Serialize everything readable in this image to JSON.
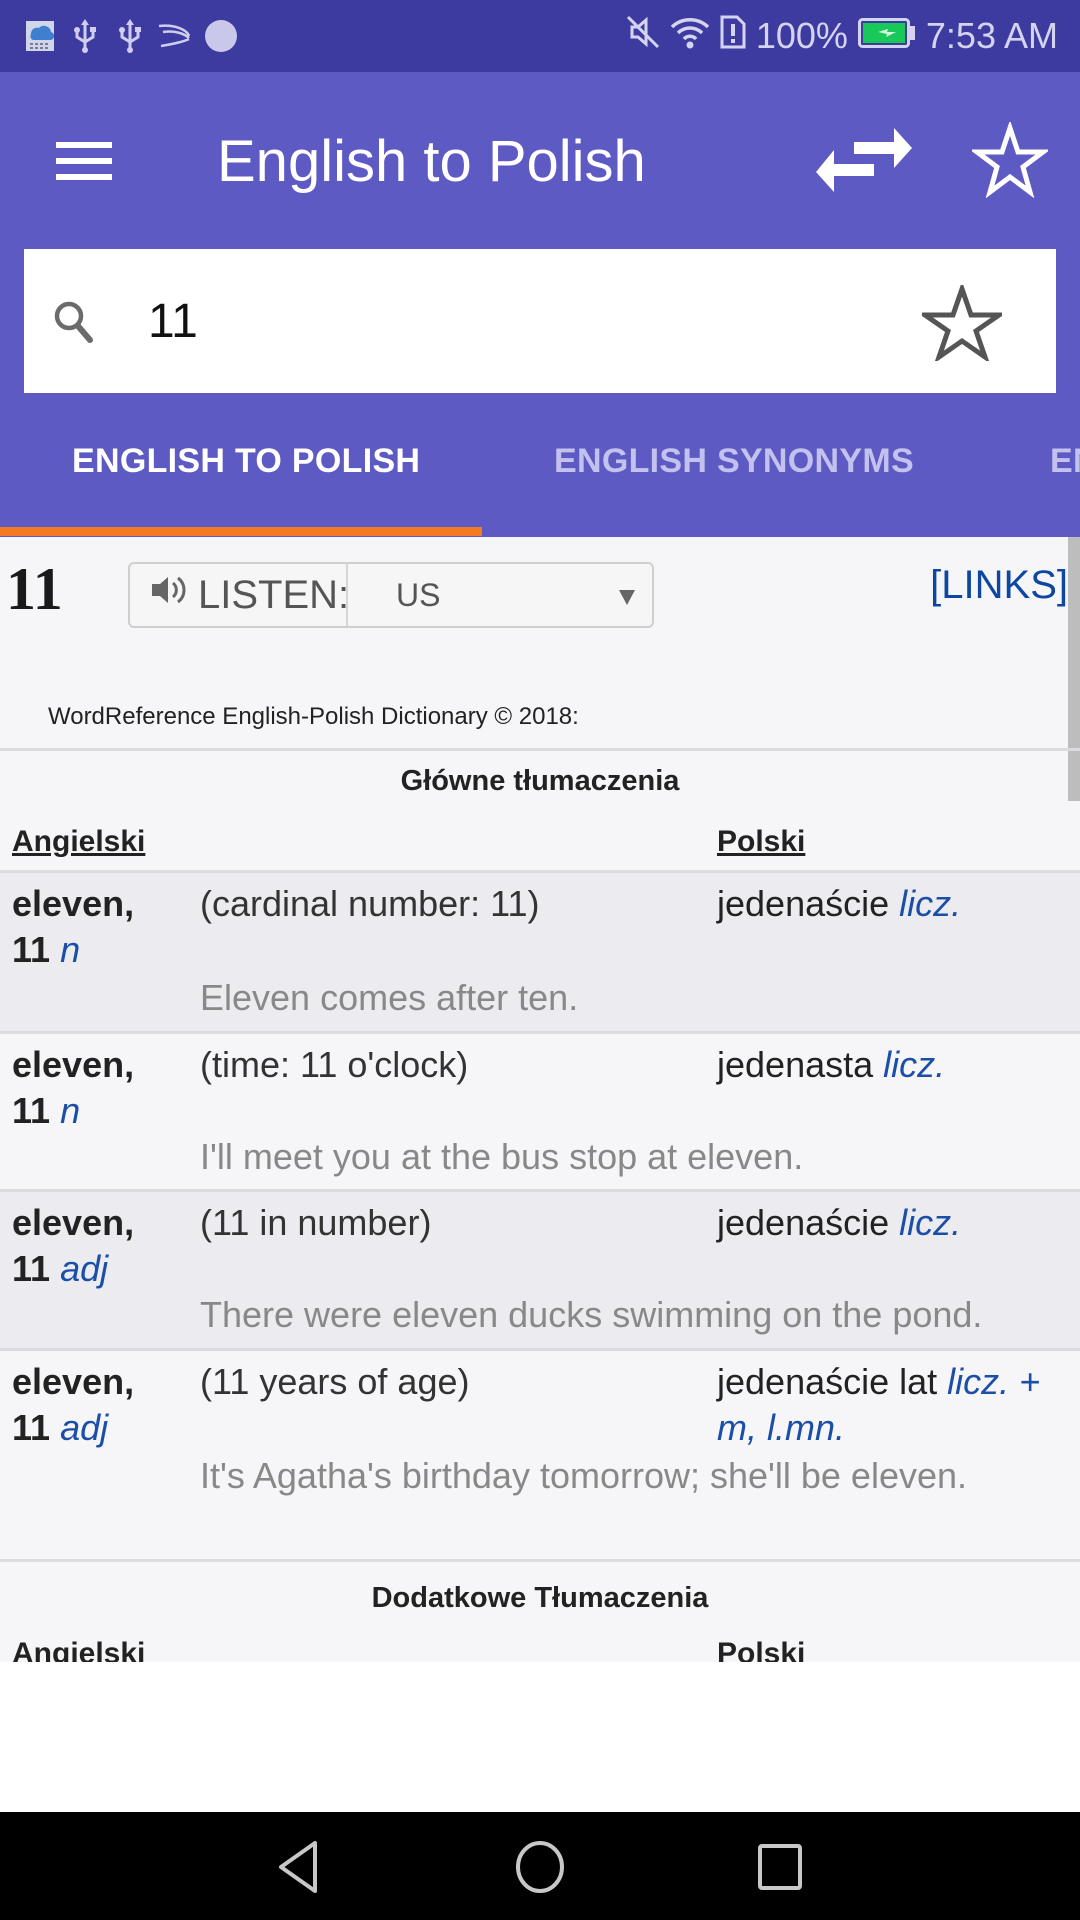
{
  "status_bar": {
    "battery_percent": "100%",
    "time": "7:53 AM",
    "left_icons": [
      "weather-widget-icon",
      "usb-icon",
      "usb-icon",
      "swiftkey-icon",
      "circle-notification-icon"
    ],
    "right_icons": [
      "mute-icon",
      "wifi-icon",
      "sim-alert-icon",
      "battery-charging-icon"
    ]
  },
  "app_bar": {
    "title": "English to Polish",
    "menu_icon": "hamburger-menu-icon",
    "swap_icon": "swap-languages-icon",
    "favorite_icon": "star-outline-icon"
  },
  "search": {
    "value": "11",
    "placeholder": "",
    "search_icon": "search-icon",
    "favorite_icon": "star-outline-icon"
  },
  "tabs": [
    {
      "label": "ENGLISH TO POLISH",
      "active": true
    },
    {
      "label": "ENGLISH SYNONYMS",
      "active": false
    },
    {
      "label": "EN",
      "active": false
    }
  ],
  "colors": {
    "status_bar": "#3d3b9f",
    "primary": "#5e5ac3",
    "tab_indicator": "#f27b22",
    "link_blue": "#0d47a1",
    "grammar_blue": "#1a4fa8"
  },
  "entry": {
    "headword": "11",
    "listen_label": "LISTEN:",
    "accent_selected": "US",
    "links_label": "[LINKS]",
    "copyright": "WordReference English-Polish Dictionary © 2018:"
  },
  "main_translations": {
    "title": "Główne tłumaczenia",
    "col_en": "Angielski",
    "col_pl": "Polski",
    "rows": [
      {
        "en": "eleven,",
        "en2": "11",
        "pos": "n",
        "sense": "(cardinal number: 11)",
        "pl": "jedenaście",
        "gram": "licz.",
        "example": "Eleven comes after ten."
      },
      {
        "en": "eleven,",
        "en2": "11",
        "pos": "n",
        "sense": "(time: 11 o'clock)",
        "pl": "jedenasta",
        "gram": "licz.",
        "example": "I'll meet you at the bus stop at eleven."
      },
      {
        "en": "eleven,",
        "en2": "11",
        "pos": "adj",
        "sense": "(11 in number)",
        "pl": "jedenaście",
        "gram": "licz.",
        "example": "There were eleven ducks swimming on the pond."
      },
      {
        "en": "eleven,",
        "en2": "11",
        "pos": "adj",
        "sense": "(11 years of age)",
        "pl": "jedenaście lat",
        "gram": "licz. + m, l.mn.",
        "example": "It's Agatha's birthday tomorrow; she'll be eleven."
      }
    ]
  },
  "additional_translations": {
    "title": "Dodatkowe Tłumaczenia",
    "col_en": "Angielski",
    "col_pl": "Polski"
  },
  "nav_bar": {
    "back_icon": "back-triangle-icon",
    "home_icon": "home-circle-icon",
    "recents_icon": "recents-square-icon"
  }
}
